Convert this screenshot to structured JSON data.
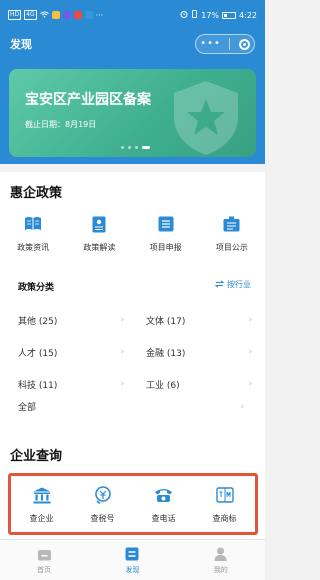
{
  "status_bar": {
    "left_chips": [
      "HD",
      "4G"
    ],
    "dots": "···",
    "battery": "17%",
    "time": "4:22"
  },
  "nav": {
    "title": "发现",
    "menu_icon": "more-dots-icon",
    "close_icon": "target-circle-icon"
  },
  "banner": {
    "title": "宝安区产业园区备案",
    "date": "截止日期：8月19日",
    "slide_count": 4,
    "active_slide": 4
  },
  "policy": {
    "title": "惠企政策",
    "icons": [
      {
        "label": "政策资讯",
        "icon": "book-icon"
      },
      {
        "label": "政策解读",
        "icon": "document-icon"
      },
      {
        "label": "项目申报",
        "icon": "list-icon"
      },
      {
        "label": "项目公示",
        "icon": "board-icon"
      }
    ],
    "category_title": "政策分类",
    "switch_label": "按行业",
    "categories": [
      [
        "其他 (25)",
        "文体 (17)"
      ],
      [
        "人才 (15)",
        "金融 (13)"
      ],
      [
        "科技 (11)",
        "工业 (6)"
      ]
    ],
    "all_label": "全部"
  },
  "query": {
    "title": "企业查询",
    "items": [
      {
        "label": "查企业",
        "icon": "bank-icon"
      },
      {
        "label": "查税号",
        "icon": "tax-icon"
      },
      {
        "label": "查电话",
        "icon": "phone-icon"
      },
      {
        "label": "查商标",
        "icon": "trademark-icon"
      }
    ]
  },
  "tabbar": {
    "items": [
      {
        "label": "首页",
        "icon": "home-icon",
        "active": false
      },
      {
        "label": "发现",
        "icon": "discover-icon",
        "active": true
      },
      {
        "label": "我的",
        "icon": "user-icon",
        "active": false
      }
    ]
  },
  "colors": {
    "primary": "#2a8bd4",
    "banner": "#4bbd9b",
    "highlight_border": "#e0563a"
  }
}
